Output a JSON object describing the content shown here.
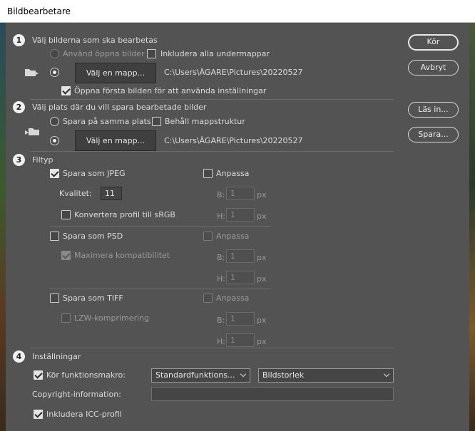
{
  "window": {
    "title": "Bildbearbetare"
  },
  "section1": {
    "number": "1",
    "title": "Välj bilderna som ska bearbetas",
    "use_open_images": "Använd öppna bilder",
    "include_subfolders": "Inkludera alla undermappar",
    "choose_folder": "Välj en mapp...",
    "path": "C:\\Users\\ÄGARE\\Pictures\\20220527",
    "open_first": "Öppna första bilden för att använda inställningar"
  },
  "section2": {
    "number": "2",
    "title": "Välj plats där du vill spara bearbetade bilder",
    "save_same": "Spara på samma plats",
    "keep_structure": "Behåll mappstruktur",
    "choose_folder": "Välj en mapp...",
    "path": "C:\\Users\\ÄGARE\\Pictures\\20220527"
  },
  "section3": {
    "number": "3",
    "title": "Filtyp",
    "jpeg": {
      "save": "Spara som JPEG",
      "resize": "Anpassa",
      "quality_label": "Kvalitet:",
      "quality_value": "11",
      "w_label": "B:",
      "w_value": "1",
      "h_label": "H:",
      "h_value": "1",
      "unit": "px",
      "convert": "Konvertera profil till sRGB"
    },
    "psd": {
      "save": "Spara som PSD",
      "resize": "Anpassa",
      "maximize": "Maximera kompatibilitet",
      "w_label": "B:",
      "w_value": "1",
      "h_label": "H:",
      "h_value": "1",
      "unit": "px"
    },
    "tiff": {
      "save": "Spara som TIFF",
      "resize": "Anpassa",
      "lzw": "LZW-komprimering",
      "w_label": "B:",
      "w_value": "1",
      "h_label": "H:",
      "h_value": "1",
      "unit": "px"
    }
  },
  "section4": {
    "number": "4",
    "title": "Inställningar",
    "run_action": "Kör funktionsmakro:",
    "action_set": "Standardfunktions...",
    "action": "Bildstorlek",
    "copyright_label": "Copyright-information:",
    "copyright_value": "",
    "icc": "Inkludera ICC-profil"
  },
  "buttons": {
    "run": "Kör",
    "cancel": "Avbryt",
    "load": "Läs in...",
    "save": "Spara..."
  }
}
